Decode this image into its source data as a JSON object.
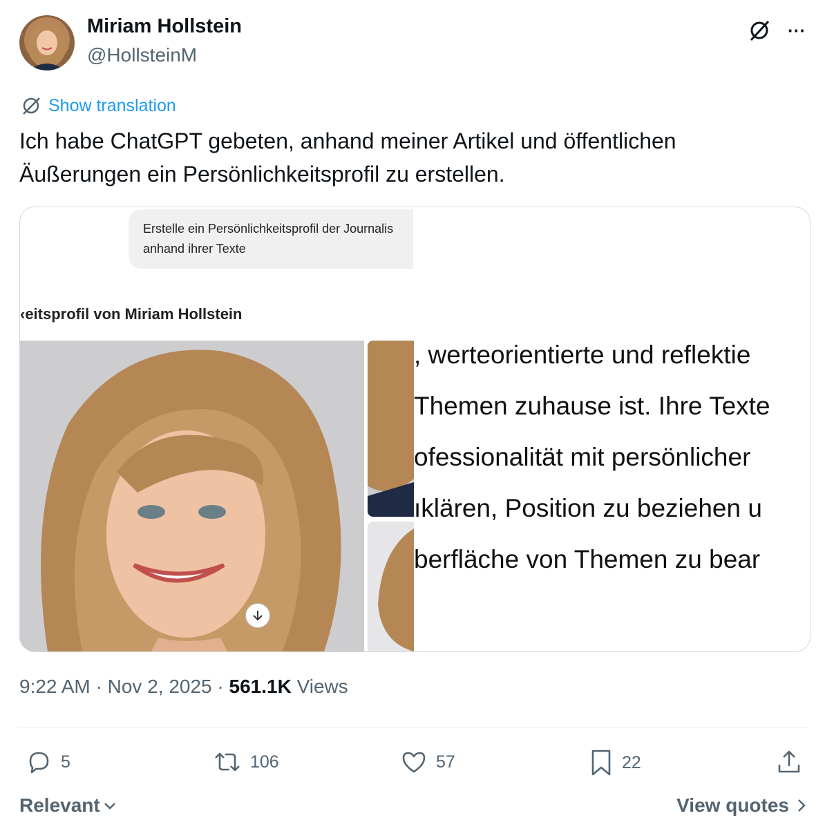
{
  "author": {
    "name": "Miriam Hollstein",
    "handle": "@HollsteinM"
  },
  "header_icons": [
    "grok-icon",
    "more-icon"
  ],
  "more_label": "···",
  "translate": {
    "label": "Show translation",
    "icon": "translate-icon"
  },
  "tweet_text": "Ich habe ChatGPT gebeten, anhand meiner Artikel und öffentlichen Äußerungen ein Persönlichkeitsprofil zu erstellen.",
  "media": {
    "prompt_lines": [
      "Erstelle ein Persönlichkeitsprofil der Journalis",
      "anhand ihrer Texte"
    ],
    "profile_title": "‹eitsprofil von Miriam Hollstein",
    "body_lines": [
      ", werteorientierte und reflektie",
      "Themen zuhause ist. Ihre Texte",
      "ofessionalität mit persönlicher",
      "ıklären, Position zu beziehen u",
      "berfläche von Themen zu bear"
    ]
  },
  "meta": {
    "time": "9:22 AM",
    "date": "Nov 2, 2025",
    "views_count": "561.1K",
    "views_label": "Views"
  },
  "actions": {
    "replies": "5",
    "reposts": "106",
    "likes": "57",
    "bookmarks": "22"
  },
  "footer": {
    "sort_label": "Relevant",
    "quotes_label": "View quotes"
  }
}
